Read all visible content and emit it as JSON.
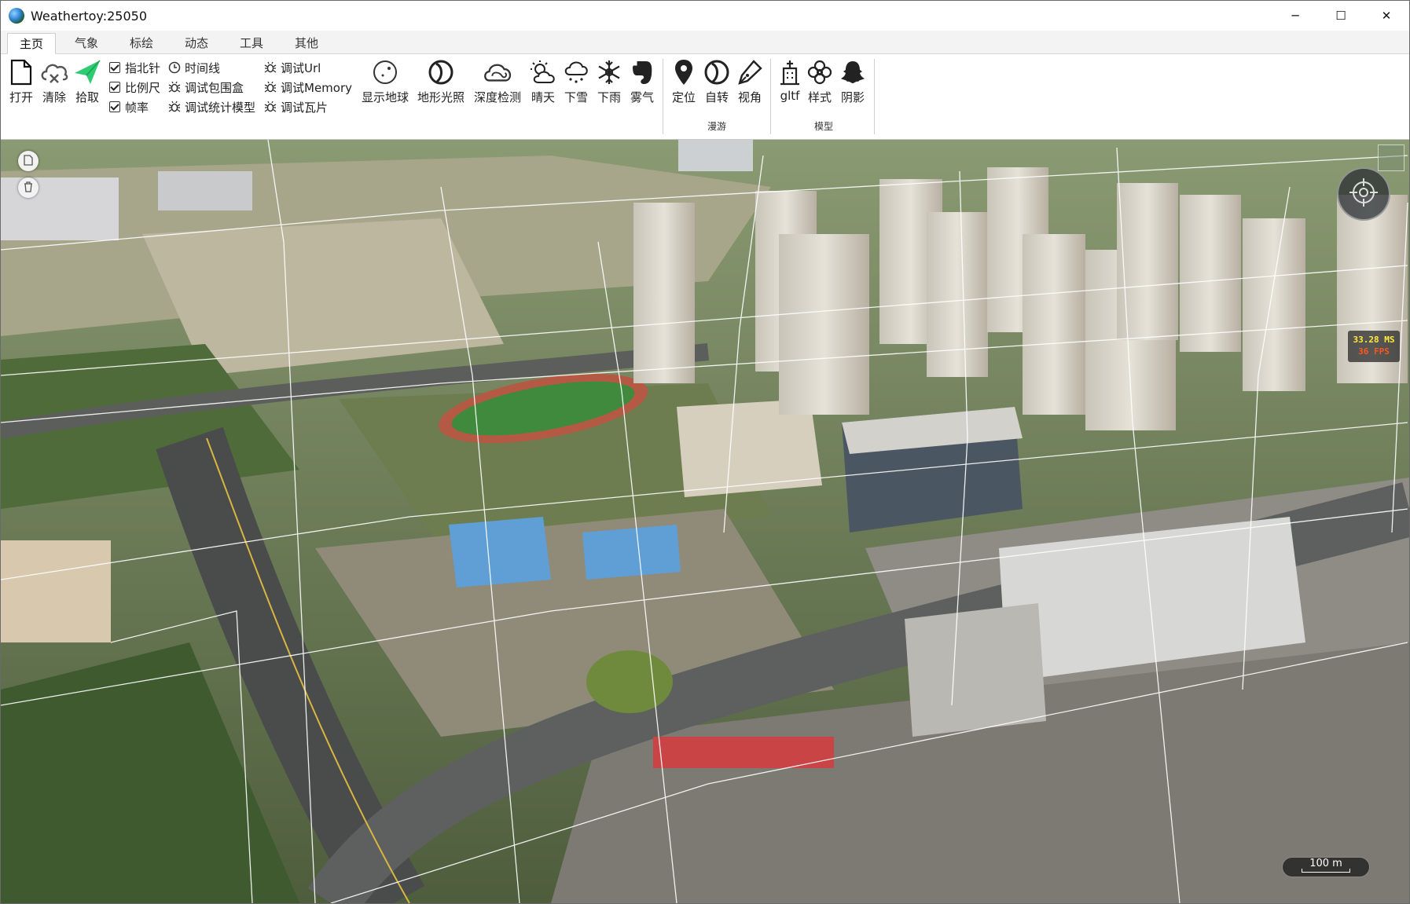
{
  "window": {
    "title": "Weathertoy:25050",
    "controls": [
      "─",
      "☐",
      "✕"
    ]
  },
  "tabs": [
    {
      "label": "主页",
      "active": true
    },
    {
      "label": "气象",
      "active": false
    },
    {
      "label": "标绘",
      "active": false
    },
    {
      "label": "动态",
      "active": false
    },
    {
      "label": "工具",
      "active": false
    },
    {
      "label": "其他",
      "active": false
    }
  ],
  "ribbon": {
    "open": "打开",
    "clear": "清除",
    "pick": "拾取",
    "checks": {
      "compass": "指北针",
      "scale": "比例尺",
      "fps": "帧率"
    },
    "timeline": "时间线",
    "debug": {
      "bbox": "调试包围盒",
      "stats_model": "调试统计模型",
      "url": "调试Url",
      "memory": "调试Memory",
      "tiles": "调试瓦片"
    },
    "show_globe": "显示地球",
    "terrain_light": "地形光照",
    "depth_test": "深度检测",
    "sunny": "晴天",
    "snow": "下雪",
    "rain": "下雨",
    "fog": "雾气",
    "locate": "定位",
    "rotate": "自转",
    "view": "视角",
    "roam_group": "漫游",
    "gltf": "gltf",
    "style": "样式",
    "shadow": "阴影",
    "model_group": "模型"
  },
  "map": {
    "fps_ms": "33.28 MS",
    "fps_value": "36 FPS",
    "scale_label": "100 m"
  }
}
